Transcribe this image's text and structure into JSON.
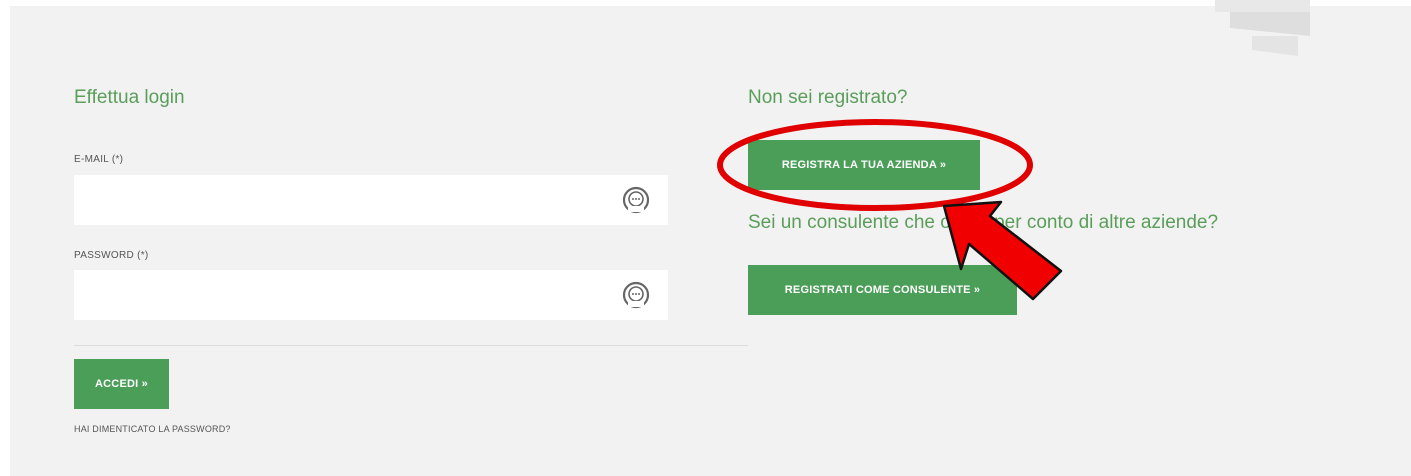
{
  "login": {
    "title": "Effettua login",
    "email_label": "E-MAIL (*)",
    "email_value": "",
    "password_label": "PASSWORD (*)",
    "password_value": "",
    "submit_label": "ACCEDI »",
    "forgot_label": "HAI DIMENTICATO LA PASSWORD?"
  },
  "register": {
    "title": "Non sei registrato?",
    "company_button": "REGISTRA LA TUA AZIENDA »",
    "consultant_question": "Sei un consulente che opera per conto di altre aziende?",
    "consultant_button": "REGISTRATI COME CONSULENTE »"
  },
  "colors": {
    "accent_green": "#4a9e58",
    "title_green": "#5a9e5a",
    "annotation_red": "#e00000"
  },
  "icons": [
    "password-manager-icon",
    "annotation-arrow",
    "annotation-ellipse"
  ]
}
